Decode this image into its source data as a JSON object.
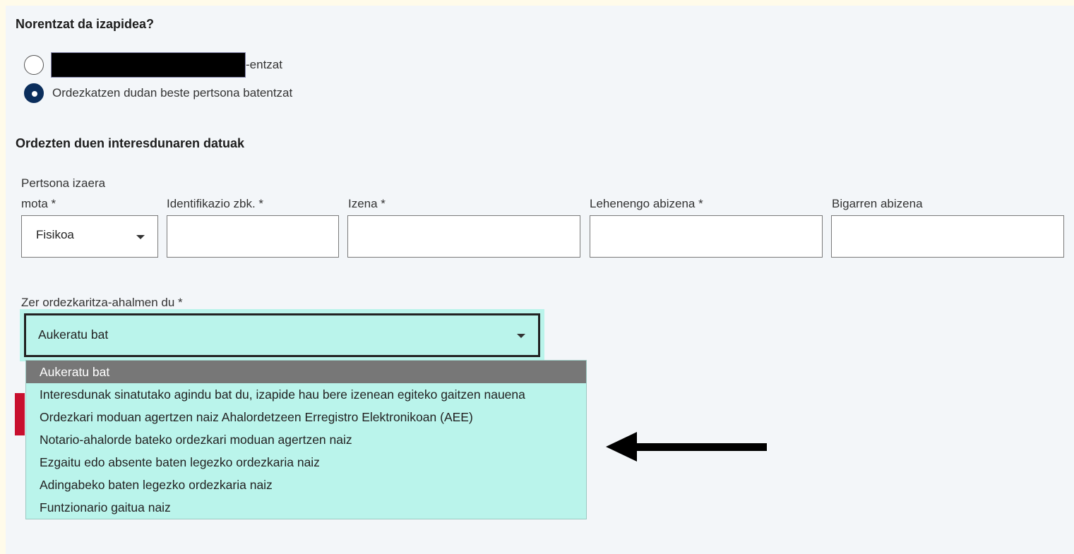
{
  "section1": {
    "title": "Norentzat da izapidea?",
    "options": [
      {
        "suffix": "-entzat",
        "checked": false
      },
      {
        "label": "Ordezkatzen dudan beste pertsona batentzat",
        "checked": true
      }
    ]
  },
  "section2": {
    "title": "Ordezten duen interesdunaren datuak",
    "person_type_label_line1": "Pertsona izaera",
    "person_type_label_line2": "mota *",
    "person_type_value": "Fisikoa",
    "id_label": "Identifikazio zbk. *",
    "name_label": "Izena *",
    "surname1_label": "Lehenengo abizena *",
    "surname2_label": "Bigarren abizena"
  },
  "representation": {
    "label": "Zer ordezkaritza-ahalmen du *",
    "value": "Aukeratu bat",
    "options": [
      "Aukeratu bat",
      "Interesdunak sinatutako agindu bat du, izapide hau bere izenean egiteko gaitzen nauena",
      "Ordezkari moduan agertzen naiz Ahalordetzeen Erregistro Elektronikoan (AEE)",
      "Notario-ahalorde bateko ordezkari moduan agertzen naiz",
      "Ezgaitu edo absente baten legezko ordezkaria naiz",
      "Adingabeko baten legezko ordezkaria naiz",
      "Funtzionario gaitua naiz"
    ]
  },
  "colors": {
    "accent_navy": "#0b2e5c",
    "select_highlight": "#baf4eb",
    "selected_option_bg": "#777777",
    "error_bar": "#c8102e"
  }
}
